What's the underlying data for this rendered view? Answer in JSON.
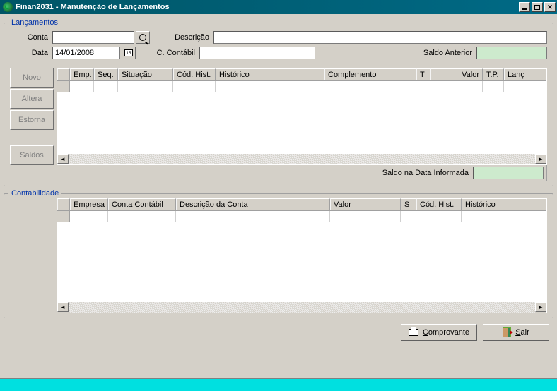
{
  "title": "Finan2031 - Manutenção de Lançamentos",
  "groups": {
    "lancamentos": "Lançamentos",
    "contabilidade": "Contabilidade"
  },
  "form": {
    "conta_label": "Conta",
    "conta_value": "",
    "data_label": "Data",
    "data_value": "14/01/2008",
    "descricao_label": "Descrição",
    "descricao_value": "",
    "ccontabil_label": "C. Contábil",
    "ccontabil_value": "",
    "saldo_anterior_label": "Saldo Anterior",
    "saldo_anterior_value": ""
  },
  "side": {
    "novo": "Novo",
    "altera": "Altera",
    "estorna": "Estorna",
    "saldos": "Saldos"
  },
  "grid1": {
    "columns": [
      "",
      "Emp.",
      "Seq.",
      "Situação",
      "Cód. Hist.",
      "Histórico",
      "Complemento",
      "T",
      "Valor",
      "T.P.",
      "Lanç"
    ],
    "rows": []
  },
  "saldo_data_label": "Saldo na Data Informada",
  "saldo_data_value": "",
  "grid2": {
    "columns": [
      "",
      "Empresa",
      "Conta Contábil",
      "Descrição da Conta",
      "Valor",
      "S",
      "Cód. Hist.",
      "Histórico"
    ],
    "rows": []
  },
  "footer": {
    "comprovante": "Comprovante",
    "sair": "Sair"
  }
}
